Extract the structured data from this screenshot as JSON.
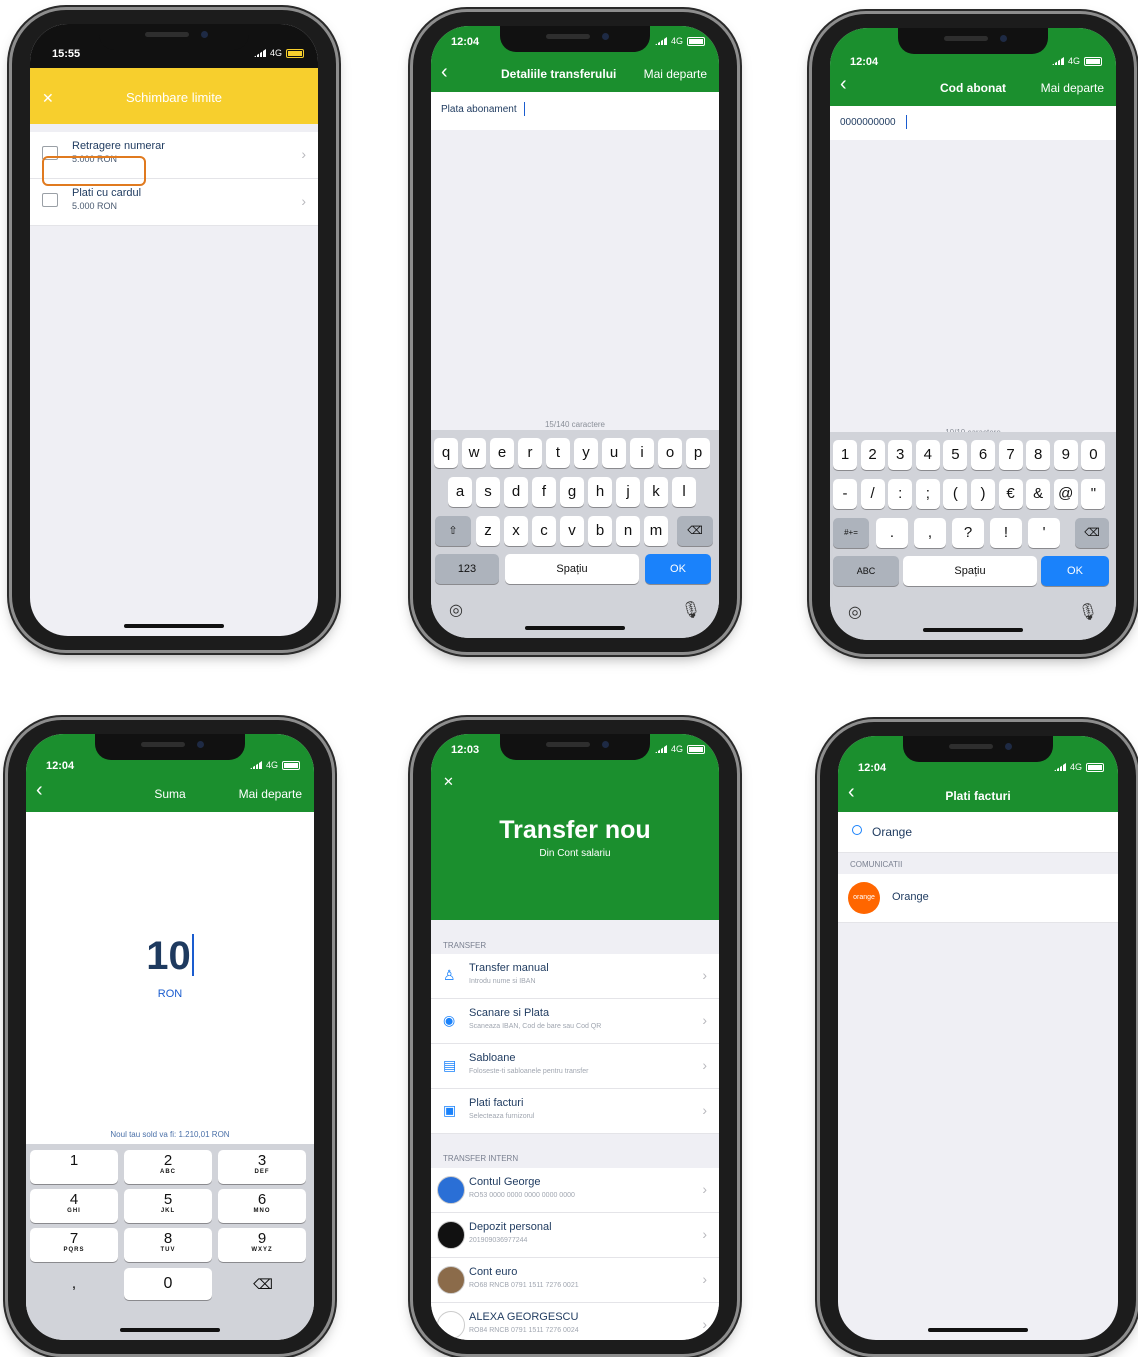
{
  "phone1": {
    "status_time": "15:55",
    "status_net": "4G",
    "title": "Schimbare limite",
    "close": "✕",
    "items": [
      {
        "label": "Retragere numerar",
        "sub": "5.000 RON"
      },
      {
        "label": "Plati cu cardul",
        "sub": "5.000 RON"
      }
    ],
    "accent_color": "#f7cf2d"
  },
  "phone2": {
    "status_time": "12:04",
    "status_net": "4G",
    "title": "Detaliile transferului",
    "action": "Mai departe",
    "input_value": "Plata abonament",
    "counter": "15/140 caractere",
    "keys_row1": [
      "q",
      "w",
      "e",
      "r",
      "t",
      "y",
      "u",
      "i",
      "o",
      "p"
    ],
    "keys_row2": [
      "a",
      "s",
      "d",
      "f",
      "g",
      "h",
      "j",
      "k",
      "l"
    ],
    "keys_row3": [
      "z",
      "x",
      "c",
      "v",
      "b",
      "n",
      "m"
    ],
    "key_123": "123",
    "key_space": "Spațiu",
    "key_ok": "OK"
  },
  "phone3": {
    "status_time": "12:04",
    "status_net": "4G",
    "title": "Cod abonat",
    "action": "Mai departe",
    "input_value": "0000000000",
    "counter": "10/10 caractere",
    "keys_row1": [
      "1",
      "2",
      "3",
      "4",
      "5",
      "6",
      "7",
      "8",
      "9",
      "0"
    ],
    "keys_row2": [
      "-",
      "/",
      ":",
      ";",
      "(",
      ")",
      "€",
      "&",
      "@",
      "\""
    ],
    "keys_row3": [
      ".",
      ",",
      "?",
      "!",
      "'"
    ],
    "key_sym": "#+=",
    "key_abc": "ABC",
    "key_space": "Spațiu",
    "key_ok": "OK"
  },
  "phone4": {
    "status_time": "12:04",
    "status_net": "4G",
    "title": "Suma",
    "action": "Mai departe",
    "amount": "10",
    "currency": "RON",
    "new_balance": "Noul tau sold va fi: 1.210,01 RON",
    "keys": [
      {
        "d": "1",
        "l": ""
      },
      {
        "d": "2",
        "l": "ABC"
      },
      {
        "d": "3",
        "l": "DEF"
      },
      {
        "d": "4",
        "l": "GHI"
      },
      {
        "d": "5",
        "l": "JKL"
      },
      {
        "d": "6",
        "l": "MNO"
      },
      {
        "d": "7",
        "l": "PQRS"
      },
      {
        "d": "8",
        "l": "TUV"
      },
      {
        "d": "9",
        "l": "WXYZ"
      }
    ],
    "key_comma": ",",
    "key_zero": "0"
  },
  "phone5": {
    "status_time": "12:03",
    "status_net": "4G",
    "close": "✕",
    "headline": "Transfer nou",
    "subhead": "Din Cont salariu",
    "section1": "TRANSFER",
    "items1": [
      {
        "label": "Transfer manual",
        "sub": "Introdu nume si IBAN"
      },
      {
        "label": "Scanare si Plata",
        "sub": "Scaneaza IBAN, Cod de bare sau Cod QR"
      },
      {
        "label": "Sabloane",
        "sub": "Foloseste-ti sabloanele pentru transfer"
      },
      {
        "label": "Plati facturi",
        "sub": "Selecteaza furnizorul"
      }
    ],
    "section2": "TRANSFER INTERN",
    "items2": [
      {
        "label": "Contul George",
        "sub": "RO53 0000 0000 0000 0000 0000"
      },
      {
        "label": "Depozit personal",
        "sub": "201909036977244"
      },
      {
        "label": "Cont euro",
        "sub": "RO68 RNCB 0791 1511 7276 0021"
      },
      {
        "label": "ALEXA GEORGESCU",
        "sub": "RO84 RNCB 0791 1511 7276 0024"
      }
    ]
  },
  "phone6": {
    "status_time": "12:04",
    "status_net": "4G",
    "title": "Plati facturi",
    "search_value": "Orange",
    "section": "COMUNICATII",
    "provider": "Orange",
    "provider_logo": "orange"
  },
  "colors": {
    "green": "#1b8f2e",
    "yellow": "#f7cf2d",
    "blue": "#1a82fb",
    "orange": "#e07a1f"
  }
}
